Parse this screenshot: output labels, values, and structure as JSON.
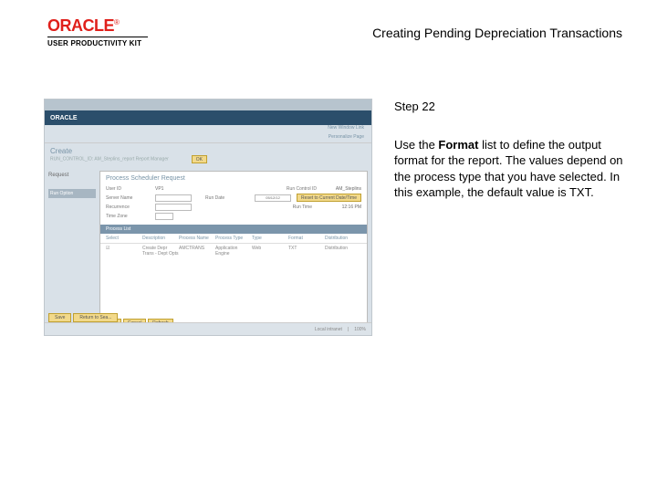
{
  "brand": {
    "oracle": "ORACLE",
    "tm": "®",
    "upk": "USER PRODUCTIVITY KIT"
  },
  "doc": {
    "title": "Creating Pending Depreciation Transactions"
  },
  "screenshot": {
    "nav": [
      "",
      "",
      "",
      "",
      ""
    ],
    "band": "ORACLE",
    "newlink": "New Window Link",
    "personalize": "Personalize Page",
    "create": "Create",
    "sublabel": "RUN_CONTROL_ID: AM_Steplins_report  Report Manager",
    "okbtn": "OK",
    "left": {
      "request": "Request",
      "runopt": "Run Option"
    },
    "modal": {
      "title": "Process Scheduler Request",
      "userid_lbl": "User ID",
      "userid_val": "VP1",
      "runctl_lbl": "Run Control ID",
      "runctl_val": "AM_Steplins",
      "server_lbl": "Server Name",
      "rundate_lbl": "Run Date",
      "rundate_val": "05/12/12",
      "resetbtn": "Reset to Current Date/Time",
      "recur_lbl": "Recurrence",
      "runtime_lbl": "Run Time",
      "runtime_val": "12:16 PM",
      "tz_lbl": "Time Zone",
      "band": "Process List",
      "headers": [
        "Select",
        "Description",
        "Process Name",
        "Process Type",
        "Type",
        "Format",
        "Distribution"
      ],
      "row": [
        "☑",
        "Create Depr Trans - Dept Opts",
        "AMCTRANS",
        "Application Engine",
        "Web",
        "TXT",
        "Distribution"
      ],
      "bottom": [
        "OK",
        "Cancel",
        "Refresh"
      ]
    },
    "tabs": [
      "Save",
      "Return to Sea..."
    ],
    "status": [
      "Local intranet",
      "100%"
    ]
  },
  "instr": {
    "step": "Step 22",
    "p1a": "Use the ",
    "p1b": "Format",
    "p1c": " list to define the output format for the report. The values depend on the process type that you have selected. In this example, the default value is TXT."
  }
}
